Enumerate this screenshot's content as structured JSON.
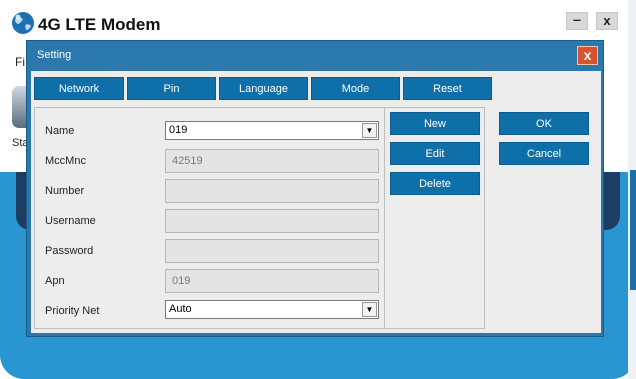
{
  "app": {
    "title": "4G LTE Modem",
    "minimize_label": "‒",
    "close_label": "x",
    "menu_stub": "Fi",
    "status_stub": "Sta"
  },
  "dialog": {
    "title": "Setting",
    "close_label": "x",
    "tabs": [
      "Network",
      "Pin",
      "Language",
      "Mode",
      "Reset"
    ],
    "fields": {
      "name": {
        "label": "Name",
        "value": "019"
      },
      "mccmnc": {
        "label": "MccMnc",
        "value": "42519"
      },
      "number": {
        "label": "Number",
        "value": ""
      },
      "username": {
        "label": "Username",
        "value": ""
      },
      "password": {
        "label": "Password",
        "value": ""
      },
      "apn": {
        "label": "Apn",
        "value": "019"
      },
      "priority_net": {
        "label": "Priority Net",
        "value": "Auto"
      }
    },
    "buttons": {
      "new": "New",
      "edit": "Edit",
      "delete": "Delete",
      "ok": "OK",
      "cancel": "Cancel"
    }
  },
  "colors": {
    "dialog_frame": "#2a78ae",
    "button_blue": "#0f6fa8",
    "app_blue": "#2a96d1",
    "close_red": "#d9532f"
  },
  "icons": {
    "app_logo": "globe-icon",
    "dropdown": "chevron-down-icon",
    "dialog_close": "close-icon"
  }
}
